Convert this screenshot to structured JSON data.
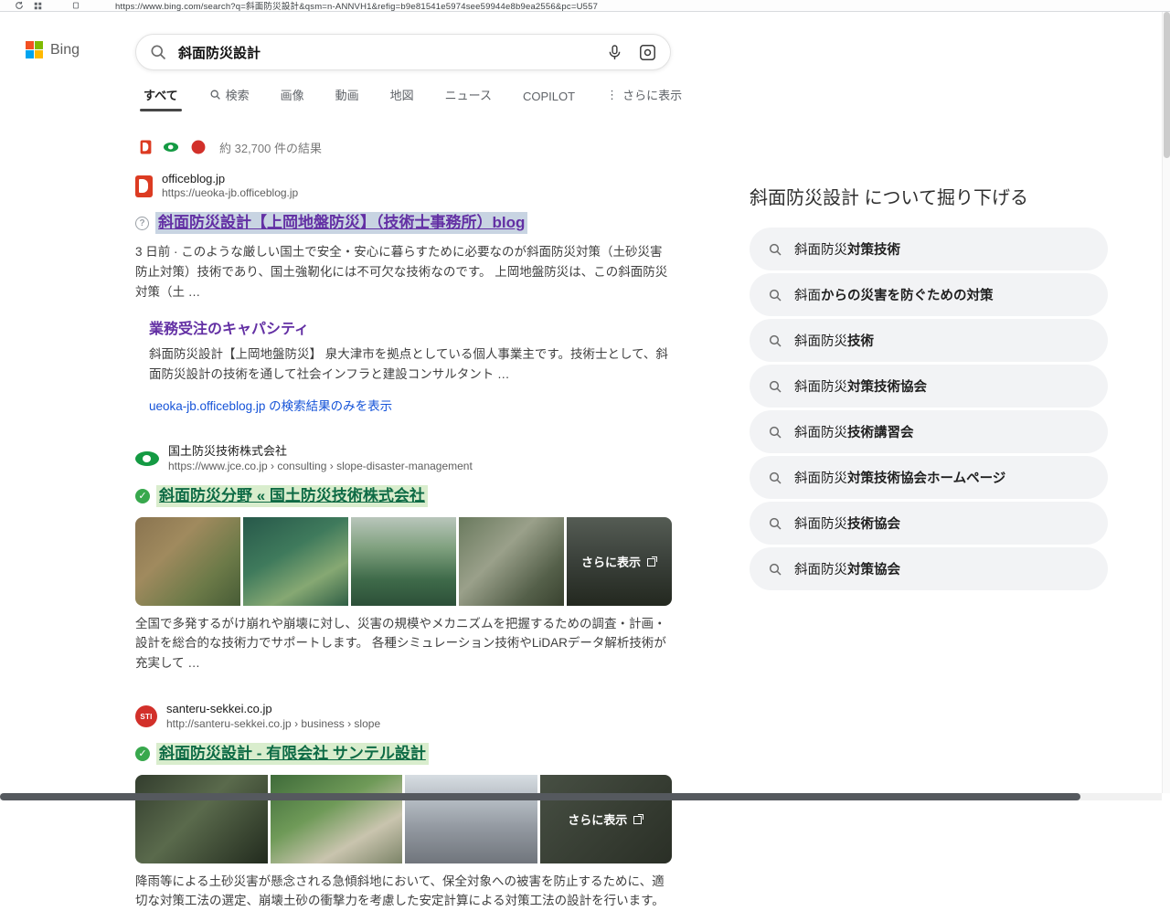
{
  "browser": {
    "url": "https://www.bing.com/search?q=斜面防災設計&qsm=n-ANNVH1&refig=b9e81541e5974see59944e8b9ea2556&pc=U557"
  },
  "header": {
    "logo_text": "Bing",
    "search": {
      "value": "斜面防災設計"
    }
  },
  "tabs": [
    {
      "label": "すべて"
    },
    {
      "label": "検索"
    },
    {
      "label": "画像"
    },
    {
      "label": "動画"
    },
    {
      "label": "地図"
    },
    {
      "label": "ニュース"
    },
    {
      "label": "COPILOT"
    },
    {
      "label": "さらに表示"
    }
  ],
  "meta": {
    "count_text": "約 32,700 件の結果"
  },
  "icons": {
    "question": "?",
    "check": "✓",
    "more_dots": "⋮"
  },
  "results": [
    {
      "site": "officeblog.jp",
      "url": "https://ueoka-jb.officeblog.jp",
      "title": "斜面防災設計【上岡地盤防災】（技術士事務所）blog",
      "snippet": "3 日前 · このような厳しい国土で安全・安心に暮らすために必要なのが斜面防災対策（土砂災害防止対策）技術であり、国土強靭化には不可欠な技術なのです。 上岡地盤防災は、この斜面防災対策（土 …",
      "sublink": {
        "title": "業務受注のキャパシティ",
        "snippet": "斜面防災設計【上岡地盤防災】 泉大津市を拠点としている個人事業主です。技術士として、斜面防災設計の技術を通して社会インフラと建設コンサルタント …"
      },
      "site_only_link": "ueoka-jb.officeblog.jp の検索結果のみを表示"
    },
    {
      "site": "国土防災技術株式会社",
      "url": "https://www.jce.co.jp › consulting › slope-disaster-management",
      "title": "斜面防災分野 « 国土防災技術株式会社",
      "more_label": "さらに表示",
      "snippet": "全国で多発するがけ崩れや崩壊に対し、災害の規模やメカニズムを把握するための調査・計画・設計を総合的な技術力でサポートします。 各種シミュレーション技術やLiDARデータ解析技術が充実して …"
    },
    {
      "site": "santeru-sekkei.co.jp",
      "url": "http://santeru-sekkei.co.jp › business › slope",
      "favicon_text": "STI",
      "title": "斜面防災設計 - 有限会社 サンテル設計",
      "more_label": "さらに表示",
      "snippet": "降雨等による土砂災害が懸念される急傾斜地において、保全対象への被害を防止するために、適切な対策工法の選定、崩壊土砂の衝撃力を考慮した安定計算による対策工法の設計を行います。"
    }
  ],
  "sidebar": {
    "title": "斜面防災設計 について掘り下げる",
    "related": [
      {
        "normal": "斜面防災",
        "bold": "対策技術"
      },
      {
        "normal": "斜面",
        "bold": "からの災害を防ぐための対策"
      },
      {
        "normal": "斜面防災",
        "bold": "技術"
      },
      {
        "normal": "斜面防災",
        "bold": "対策技術協会"
      },
      {
        "normal": "斜面防災",
        "bold": "技術講習会"
      },
      {
        "normal": "斜面防災",
        "bold": "対策技術協会ホームページ"
      },
      {
        "normal": "斜面防災",
        "bold": "技術協会"
      },
      {
        "normal": "斜面防災",
        "bold": "対策協会"
      }
    ]
  },
  "colors": {
    "visited_link": "#6330a4",
    "blue_link": "#1553d8",
    "green_title": "#0e6b45",
    "green_highlight": "#d9edcd",
    "blue_highlight": "#c8d4e2",
    "check_green": "#38a84d"
  }
}
